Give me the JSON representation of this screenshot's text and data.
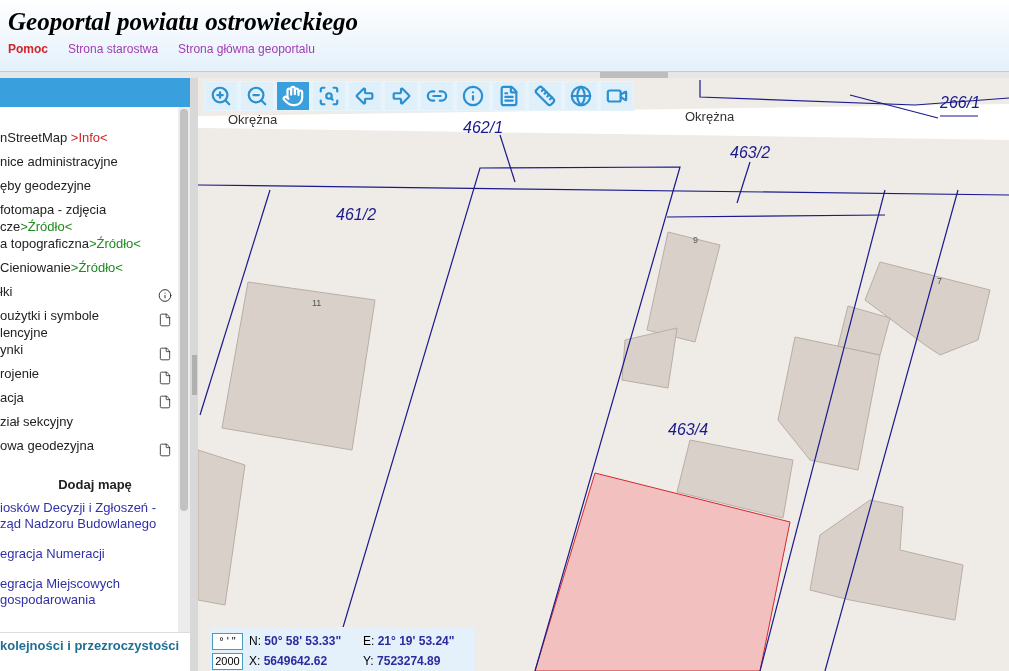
{
  "header": {
    "title": "Geoportal powiatu ostrowieckiego",
    "links": [
      {
        "label": "Pomoc",
        "kind": "help"
      },
      {
        "label": "Strona starostwa",
        "kind": "site"
      },
      {
        "label": "Strona główna geoportalu",
        "kind": "site"
      }
    ]
  },
  "layers": [
    {
      "lines": [
        "nStreetMap "
      ],
      "source": {
        "text": ">Info<",
        "kind": "info"
      },
      "kind": "plain"
    },
    {
      "lines": [
        "nice administracyjne"
      ],
      "kind": "plain"
    },
    {
      "lines": [
        "ęby geodezyjne"
      ],
      "kind": "plain"
    },
    {
      "lines": [
        "fotomapa - zdjęcia",
        "cze"
      ],
      "source": {
        "text": ">Źródło<",
        "kind": "source"
      },
      "kind": "plain"
    },
    {
      "lines": [
        "a topograficzna"
      ],
      "source": {
        "text": ">Źródło<",
        "kind": "source"
      },
      "kind": "plain"
    },
    {
      "lines": [
        "Cieniowanie"
      ],
      "source": {
        "text": ">Źródło<",
        "kind": "source"
      },
      "kind": "plain"
    },
    {
      "lines": [
        "łki"
      ],
      "kind": "with-info"
    },
    {
      "lines": [
        "oużytki i symbole",
        "lencyjne"
      ],
      "kind": "with-legend"
    },
    {
      "lines": [
        "ynki"
      ],
      "kind": "with-legend"
    },
    {
      "lines": [
        "rojenie"
      ],
      "kind": "with-legend"
    },
    {
      "lines": [
        "acja"
      ],
      "kind": "with-legend"
    },
    {
      "lines": [
        "ział sekcyjny"
      ],
      "kind": "plain"
    },
    {
      "lines": [
        "owa geodezyjna"
      ],
      "kind": "with-legend"
    }
  ],
  "add_map": {
    "heading": "Dodaj mapę",
    "links": [
      {
        "lines": [
          "iosków Decyzji i Zgłoszeń -",
          "ząd Nadzoru Budowlanego"
        ]
      },
      {
        "lines": [
          "egracja Numeracji"
        ]
      },
      {
        "lines": [
          "egracja Miejscowych",
          "gospodarowania"
        ]
      }
    ]
  },
  "panel_footer": "kolejności i przezroczystości",
  "toolbar": [
    {
      "kind": "zoom-in",
      "selected": false
    },
    {
      "kind": "zoom-out",
      "selected": false
    },
    {
      "kind": "pan",
      "selected": true
    },
    {
      "kind": "zoom-extent",
      "selected": false
    },
    {
      "kind": "back",
      "selected": false
    },
    {
      "kind": "forward",
      "selected": false
    },
    {
      "kind": "link",
      "selected": false
    },
    {
      "kind": "info",
      "selected": false
    },
    {
      "kind": "info-area",
      "selected": false
    },
    {
      "kind": "measure",
      "selected": false
    },
    {
      "kind": "globe",
      "selected": false
    },
    {
      "kind": "video",
      "selected": false
    }
  ],
  "map_labels": [
    {
      "text": "Okrężna",
      "kind": "street"
    },
    {
      "text": "Okrężna",
      "kind": "street"
    },
    {
      "text": "462/1",
      "kind": "parcel"
    },
    {
      "text": "463/2",
      "kind": "parcel"
    },
    {
      "text": "266/1",
      "kind": "parcel"
    },
    {
      "text": "461/2",
      "kind": "parcel"
    },
    {
      "text": "9",
      "kind": "house"
    },
    {
      "text": "11",
      "kind": "house"
    },
    {
      "text": "7",
      "kind": "house"
    },
    {
      "text": "463/4",
      "kind": "parcel"
    }
  ],
  "coordinates": [
    {
      "format": "° ' \"",
      "label_1": "N:",
      "value_1": "50° 58' 53.33\"",
      "label_2": "E:",
      "value_2": "21° 19' 53.24\""
    },
    {
      "format": "2000",
      "label_1": "X:",
      "value_1": "5649642.62",
      "label_2": "Y:",
      "value_2": "7523274.89"
    }
  ]
}
